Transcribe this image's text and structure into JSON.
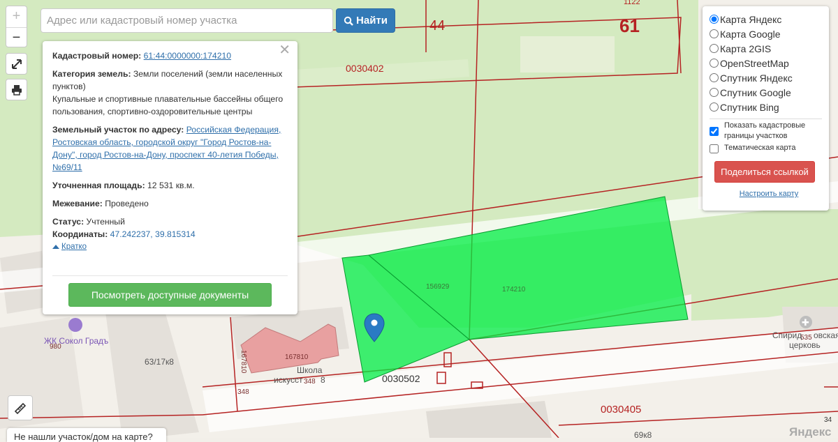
{
  "search": {
    "placeholder": "Адрес или кадастровый номер участка",
    "button_label": "Найти"
  },
  "zoom": {
    "in": "+",
    "out": "−"
  },
  "popup": {
    "cadastral_label": "Кадастровый номер:",
    "cadastral_value": "61:44:0000000:174210",
    "category_label": "Категория земель:",
    "category_value": "Земли поселений (земли населенных пунктов)",
    "usage_value": "Купальные и спортивные плавательные бассейны общего пользования, спортивно-оздоровительные центры",
    "address_label": "Земельный участок по адресу:",
    "address_value": "Российская Федерация, Ростовская область, городской округ \"Город Ростов-на-Дону\", город Ростов-на-Дону, проспект 40-летия Победы, №69/11",
    "area_label": "Уточненная площадь:",
    "area_value": "12 531 кв.м.",
    "survey_label": "Межевание:",
    "survey_value": "Проведено",
    "status_label": "Статус:",
    "status_value": "Учтенный",
    "coords_label": "Координаты:",
    "coords_value": "47.242237, 39.815314",
    "brief_link": "Кратко",
    "docs_button": "Посмотреть доступные документы"
  },
  "layers": {
    "options": [
      "Карта Яндекс",
      "Карта Google",
      "Карта 2GIS",
      "OpenStreetMap",
      "Спутник Яндекс",
      "Спутник Google",
      "Спутник Bing"
    ],
    "selected": "Карта Яндекс",
    "show_borders": "Показать кадастровые границы участков",
    "thematic": "Тематическая карта",
    "share_button": "Поделиться ссылкой",
    "setup_link": "Настроить карту"
  },
  "map_labels": {
    "block_44": "44",
    "block_61": "61",
    "num_1122": "1122",
    "q_0030402": "0030402",
    "q_0030502": "0030502",
    "q_0030405": "0030405",
    "parcel_156929": "156929",
    "parcel_174210": "174210",
    "parcel_167810": "167810",
    "parcel_167810_v": "167810",
    "n_348a": "348",
    "n_348b": "348",
    "house_63": "63/17к8",
    "house_69": "69к8",
    "n_980": "980",
    "n_535": "535",
    "n_34": "34",
    "poi_sokol": "ЖК Сокол Градъ",
    "poi_school_a": "Школа",
    "poi_school_b": "искусст",
    "poi_school_c": "8",
    "poi_church_a": "Спирид",
    "poi_church_b": "овская",
    "poi_church_c": "церковь",
    "yandex": "Яндекс"
  },
  "colors": {
    "parcel_fill": "#00ee44",
    "border": "#b52222",
    "green_area": "#d6ebc2",
    "building": "#e8a0a0"
  },
  "footer": {
    "not_found": "Не нашли участок/дом на карте?"
  }
}
